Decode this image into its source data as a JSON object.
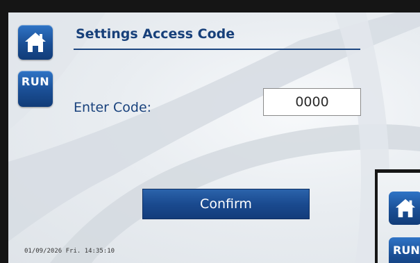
{
  "screen": {
    "title": "Settings Access Code",
    "code_label": "Enter Code:",
    "code_value": "0000",
    "confirm_label": "Confirm",
    "datetime": "01/09/2026 Fri. 14:35:10"
  },
  "sidebar": {
    "home_icon": "home-icon",
    "run_label": "RUN"
  },
  "overlay_panel": {
    "home_icon": "home-icon",
    "run_label": "RUN"
  },
  "colors": {
    "accent": "#1a4e94",
    "title_text": "#17407a",
    "background": "#e9edf1"
  }
}
